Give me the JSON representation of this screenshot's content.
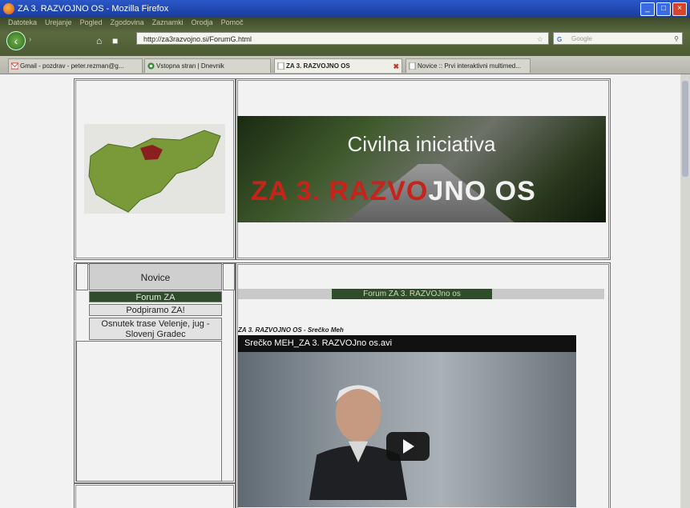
{
  "window": {
    "title": "ZA 3. RAZVOJNO OS - Mozilla Firefox",
    "controls": [
      "_",
      "□",
      "×"
    ]
  },
  "menubar": {
    "items": [
      "Datoteka",
      "Urejanje",
      "Pogled",
      "Zgodovina",
      "Zaznamki",
      "Orodja",
      "Pomoč"
    ]
  },
  "navbar": {
    "url": "http://za3razvojno.si/ForumG.html",
    "search_placeholder": "Google"
  },
  "tabs": [
    {
      "label": "Gmail - pozdrav - peter.rezman@g...",
      "icon": "gmail-icon",
      "active": false
    },
    {
      "label": "Vstopna stran | Dnevnik",
      "icon": "dnevnik-icon",
      "active": false
    },
    {
      "label": "ZA 3. RAZVOJNO OS",
      "icon": "page-icon",
      "active": true
    },
    {
      "label": "Novice :: Prvi interaktivni multimed...",
      "icon": "page-icon",
      "active": false
    }
  ],
  "page": {
    "banner": {
      "line1": "Civilna iniciativa",
      "line2_a": "ZA 3. RAZVO",
      "line2_b": "JNO OS"
    },
    "sidebar": {
      "heading": "Novice",
      "items": [
        {
          "label": "Forum ZA",
          "active": true
        },
        {
          "label": "Podpiramo ZA!",
          "active": false
        },
        {
          "label": "Osnutek trase Velenje, jug - Slovenj Gradec",
          "active": false
        }
      ]
    },
    "forum_bar": "Forum ZA 3. RAZVOJno os",
    "video": {
      "caption": "ZA 3. RAZVOJNO OS - Srečko Meh",
      "title": "Srečko MEH_ZA 3. RAZVOJno os.avi"
    }
  },
  "colors": {
    "accent_green": "#2f4d2a",
    "banner_red": "#c7231b"
  }
}
